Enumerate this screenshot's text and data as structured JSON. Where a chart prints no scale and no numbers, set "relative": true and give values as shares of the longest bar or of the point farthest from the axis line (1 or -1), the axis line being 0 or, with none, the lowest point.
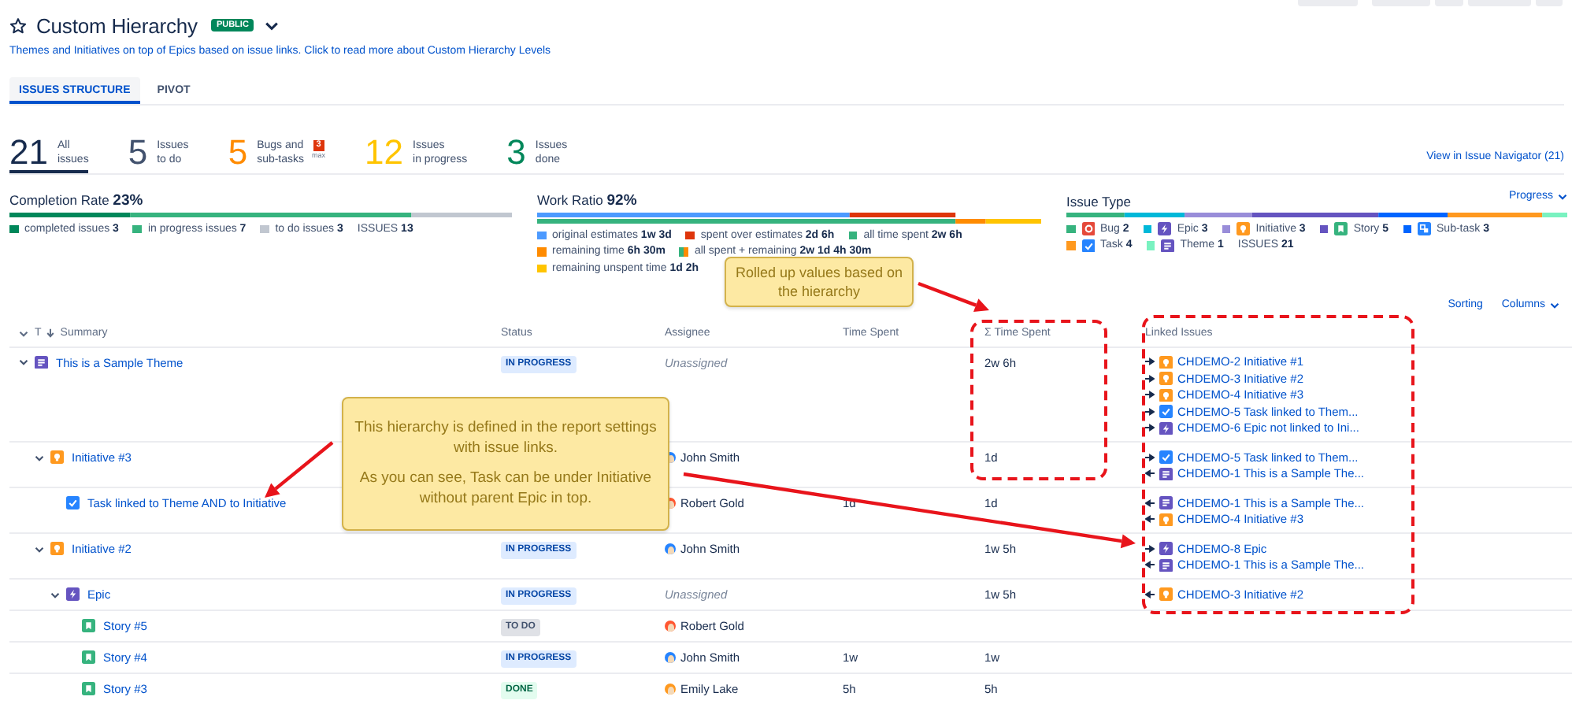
{
  "header": {
    "title": "Custom Hierarchy",
    "badge": "PUBLIC",
    "description": "Themes and Initiatives on top of Epics based on issue links. Click to read more about Custom Hierarchy Levels"
  },
  "tabs": [
    {
      "label": "ISSUES STRUCTURE",
      "selected": true
    },
    {
      "label": "PIVOT",
      "selected": false
    }
  ],
  "counters": [
    {
      "number": "21",
      "lines": [
        "All",
        "issues"
      ],
      "color": "#172b4d",
      "selected": true
    },
    {
      "number": "5",
      "lines": [
        "Issues",
        "to do"
      ],
      "color": "#42526e",
      "selected": false
    },
    {
      "number": "5",
      "lines": [
        "Bugs and",
        "sub-tasks"
      ],
      "color": "#ff8b00",
      "selected": false,
      "badge": "3",
      "badge_note": "max"
    },
    {
      "number": "12",
      "lines": [
        "Issues",
        "in progress"
      ],
      "color": "#ffc400",
      "selected": false
    },
    {
      "number": "3",
      "lines": [
        "Issues",
        "done"
      ],
      "color": "#00875a",
      "selected": false
    }
  ],
  "navigator_link": "View in Issue Navigator (21)",
  "panels": [
    {
      "title": "Completion Rate **23%**",
      "chart_data": {
        "type": "bar",
        "orientation": "horizontal",
        "stacked": true,
        "relative": true,
        "series": [
          {
            "color": "#00875a",
            "values": [
              0.24
            ]
          },
          {
            "color": "#36b37e",
            "values": [
              0.56
            ]
          },
          {
            "color": "#c1c7d0",
            "values": [
              0.2
            ]
          }
        ]
      },
      "legend_rows": [
        [
          {
            "text": "completed issues **3**",
            "swatches": [
              {
                "color": "#00875a"
              }
            ]
          },
          {
            "text": "in progress issues **7**",
            "swatches": [
              {
                "color": "#36b37e"
              }
            ]
          },
          {
            "text": "to do issues **3**",
            "swatches": [
              {
                "color": "#c1c7d0"
              }
            ]
          },
          {
            "text": "ISSUES **13**"
          }
        ]
      ]
    },
    {
      "title": "Work Ratio **92%**",
      "chart_data": {
        "type": "bar",
        "orientation": "horizontal",
        "stacked": true,
        "relative": true,
        "series": [
          {
            "color": "#4c9aff",
            "values": [
              0.62,
              null
            ]
          },
          {
            "color": "#de350b",
            "values": [
              0.21,
              null
            ]
          },
          {
            "color": "#36b37e",
            "values": [
              null,
              0.83
            ]
          },
          {
            "color": "#ff8b00",
            "values": [
              null,
              0.06
            ]
          },
          {
            "color": "#ffc400",
            "values": [
              null,
              0.11
            ]
          }
        ]
      },
      "legend_rows": [
        [
          {
            "text": "original estimates **1w 3d**",
            "swatches": [
              {
                "color": "#4c9aff"
              }
            ]
          },
          {
            "text": "spent over estimates **2d 6h**",
            "swatches": [
              {
                "color": "#de350b"
              }
            ]
          },
          {
            "text": "all time spent **2w 6h**",
            "swatches": [
              {
                "color": "#36b37e"
              }
            ]
          }
        ],
        [
          {
            "text": "remaining time **6h 30m**",
            "swatches": [
              {
                "color": "#ff8b00"
              }
            ]
          },
          {
            "text": "all spent + remaining **2w 1d 4h 30m**",
            "swatches": [
              {
                "color": "#36b37e"
              },
              {
                "color": "#ff8b00"
              }
            ]
          }
        ],
        [
          {
            "text": "remaining unspent time **1d 2h**",
            "swatches": [
              {
                "color": "#ffc400"
              }
            ]
          }
        ]
      ]
    },
    {
      "title": "Issue Type",
      "menu": "Progress",
      "chart_data": {
        "type": "bar",
        "orientation": "horizontal",
        "stacked": true,
        "relative": true,
        "series": [
          {
            "color": "#36b37e",
            "values": [
              0.116
            ]
          },
          {
            "color": "#00b8d9",
            "values": [
              0.12
            ]
          },
          {
            "color": "#998dd9",
            "values": [
              0.135
            ]
          },
          {
            "color": "#6554c0",
            "values": [
              0.252
            ]
          },
          {
            "color": "#0065ff",
            "values": [
              0.138
            ]
          },
          {
            "color": "#ff991f",
            "values": [
              0.189
            ]
          },
          {
            "color": "#79f2c0",
            "values": [
              0.05
            ]
          }
        ]
      },
      "legend_rows": [
        [
          {
            "text": "Bug **2**",
            "swatches": [
              {
                "color": "#36b37e"
              }
            ],
            "kind": "bug"
          },
          {
            "text": "Epic **3**",
            "swatches": [
              {
                "color": "#00b8d9"
              }
            ],
            "kind": "epic"
          },
          {
            "text": "Initiative **3**",
            "swatches": [
              {
                "color": "#998dd9"
              }
            ],
            "kind": "initiative"
          },
          {
            "text": "Story **5**",
            "swatches": [
              {
                "color": "#6554c0"
              }
            ],
            "kind": "story"
          },
          {
            "text": "Sub-task **3**",
            "swatches": [
              {
                "color": "#0065ff"
              }
            ],
            "kind": "subtask"
          }
        ],
        [
          {
            "text": "Task **4**",
            "swatches": [
              {
                "color": "#ff991f"
              }
            ],
            "kind": "task"
          },
          {
            "text": "Theme **1**",
            "swatches": [
              {
                "color": "#79f2c0"
              }
            ],
            "kind": "theme"
          },
          {
            "text": "ISSUES **21**"
          }
        ]
      ]
    }
  ],
  "table_controls": {
    "sorting": "Sorting",
    "columns": "Columns"
  },
  "table": {
    "type_toggle": "T",
    "columns": [
      "Summary",
      "Status",
      "Assignee",
      "Time Spent",
      "Σ Time Spent",
      "Linked Issues"
    ],
    "rows": [
      {
        "kind": "theme",
        "summary": "This is a Sample Theme",
        "expanded": true,
        "status": {
          "text": "IN PROGRESS",
          "kind": "inprogress"
        },
        "assignee": {
          "name": "Unassigned",
          "kind": "unassigned"
        },
        "sum_time_spent": "2w 6h",
        "links": [
          {
            "outward": true,
            "kind": "initiative",
            "text": "CHDEMO-2 Initiative #1"
          },
          {
            "outward": true,
            "kind": "initiative",
            "text": "CHDEMO-3 Initiative #2"
          },
          {
            "outward": true,
            "kind": "initiative",
            "text": "CHDEMO-4 Initiative #3"
          },
          {
            "outward": true,
            "kind": "task",
            "text": "CHDEMO-5 Task linked to Them..."
          },
          {
            "outward": true,
            "kind": "epic",
            "text": "CHDEMO-6 Epic not linked to Ini..."
          }
        ],
        "children": [
          {
            "kind": "initiative",
            "summary": "Initiative #3",
            "expanded": true,
            "assignee": {
              "name": "John Smith",
              "kind": "user",
              "color": "#2684ff"
            },
            "sum_time_spent": "1d",
            "links": [
              {
                "outward": true,
                "kind": "task",
                "text": "CHDEMO-5 Task linked to Them..."
              },
              {
                "outward": false,
                "kind": "theme",
                "text": "CHDEMO-1 This is a Sample The..."
              }
            ],
            "children": [
              {
                "kind": "task",
                "summary": "Task linked to Theme AND to Initiative",
                "assignee": {
                  "name": "Robert Gold",
                  "kind": "user",
                  "color": "#ff5630"
                },
                "time_spent": "1d",
                "sum_time_spent": "1d",
                "links": [
                  {
                    "outward": false,
                    "kind": "theme",
                    "text": "CHDEMO-1 This is a Sample The..."
                  },
                  {
                    "outward": false,
                    "kind": "initiative",
                    "text": "CHDEMO-4 Initiative #3"
                  }
                ]
              }
            ]
          },
          {
            "kind": "initiative",
            "summary": "Initiative #2",
            "expanded": true,
            "status": {
              "text": "IN PROGRESS",
              "kind": "inprogress"
            },
            "assignee": {
              "name": "John Smith",
              "kind": "user",
              "color": "#2684ff"
            },
            "sum_time_spent": "1w 5h",
            "links": [
              {
                "outward": true,
                "kind": "epic",
                "text": "CHDEMO-8 Epic"
              },
              {
                "outward": false,
                "kind": "theme",
                "text": "CHDEMO-1 This is a Sample The..."
              }
            ],
            "children": [
              {
                "kind": "epic",
                "summary": "Epic",
                "expanded": true,
                "status": {
                  "text": "IN PROGRESS",
                  "kind": "inprogress"
                },
                "assignee": {
                  "name": "Unassigned",
                  "kind": "unassigned"
                },
                "sum_time_spent": "1w 5h",
                "links": [
                  {
                    "outward": false,
                    "kind": "initiative",
                    "text": "CHDEMO-3 Initiative #2"
                  }
                ],
                "children": [
                  {
                    "kind": "story",
                    "summary": "Story #5",
                    "status": {
                      "text": "TO DO",
                      "kind": "todo"
                    },
                    "assignee": {
                      "name": "Robert Gold",
                      "kind": "user",
                      "color": "#ff5630"
                    }
                  },
                  {
                    "kind": "story",
                    "summary": "Story #4",
                    "status": {
                      "text": "IN PROGRESS",
                      "kind": "inprogress"
                    },
                    "assignee": {
                      "name": "John Smith",
                      "kind": "user",
                      "color": "#2684ff"
                    },
                    "time_spent": "1w",
                    "sum_time_spent": "1w"
                  },
                  {
                    "kind": "story",
                    "summary": "Story #3",
                    "status": {
                      "text": "DONE",
                      "kind": "done"
                    },
                    "assignee": {
                      "name": "Emily Lake",
                      "kind": "user",
                      "color": "#ff991f"
                    },
                    "time_spent": "5h",
                    "sum_time_spent": "5h"
                  }
                ]
              }
            ]
          }
        ]
      }
    ]
  },
  "annotations": [
    {
      "kind": "callout",
      "paragraphs": [
        "Rolled up values based on the hierarchy"
      ]
    },
    {
      "kind": "callout",
      "paragraphs": [
        "This hierarchy is defined in the report settings with issue links.",
        "As you can see, Task can be under Initiative without parent Epic in top."
      ]
    },
    {
      "kind": "highlight_box"
    },
    {
      "kind": "highlight_box"
    }
  ]
}
